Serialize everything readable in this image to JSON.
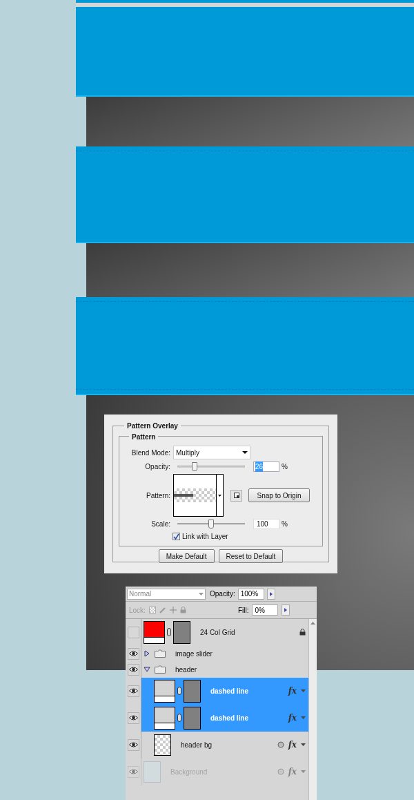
{
  "dialog": {
    "title": "Pattern Overlay",
    "group": "Pattern",
    "blend_mode": {
      "label": "Blend Mode:",
      "value": "Multiply"
    },
    "opacity": {
      "label": "Opacity:",
      "level": 0.26,
      "value": "26",
      "unit": "%"
    },
    "pattern": {
      "label": "Pattern:"
    },
    "snap_button": "Snap to Origin",
    "scale": {
      "label": "Scale:",
      "level": 0.5,
      "value": "100",
      "unit": "%"
    },
    "link": {
      "label": "Link with Layer",
      "checked": true
    },
    "buttons": [
      "Make Default",
      "Reset to Default"
    ]
  },
  "layers_panel": {
    "blend_mode": "Normal",
    "opacity": {
      "label": "Opacity:",
      "value": "100%"
    },
    "lock_label": "Lock:",
    "fill": {
      "label": "Fill:",
      "value": "0%"
    },
    "layers": [
      {
        "name": "24 Col Grid",
        "kind": "fill",
        "color": "#ff0000",
        "visible": false,
        "locked": true,
        "selected": false
      },
      {
        "name": "image slider",
        "kind": "group",
        "visible": true,
        "expanded": false,
        "selected": false
      },
      {
        "name": "header",
        "kind": "group",
        "visible": true,
        "expanded": true,
        "selected": false,
        "children": [
          {
            "name": "dashed line",
            "kind": "fill",
            "color": "#d4d4d4",
            "visible": true,
            "selected": true,
            "fx": "fx"
          },
          {
            "name": "dashed line",
            "kind": "fill",
            "color": "#d4d4d4",
            "visible": true,
            "selected": true,
            "fx": "fx"
          },
          {
            "name": "header bg",
            "kind": "pixel",
            "visible": true,
            "selected": false,
            "fx": "fx"
          }
        ]
      },
      {
        "name": "Background",
        "kind": "pixel",
        "visible": true,
        "selected": false,
        "fx": "fx",
        "dimmed": true
      }
    ]
  }
}
